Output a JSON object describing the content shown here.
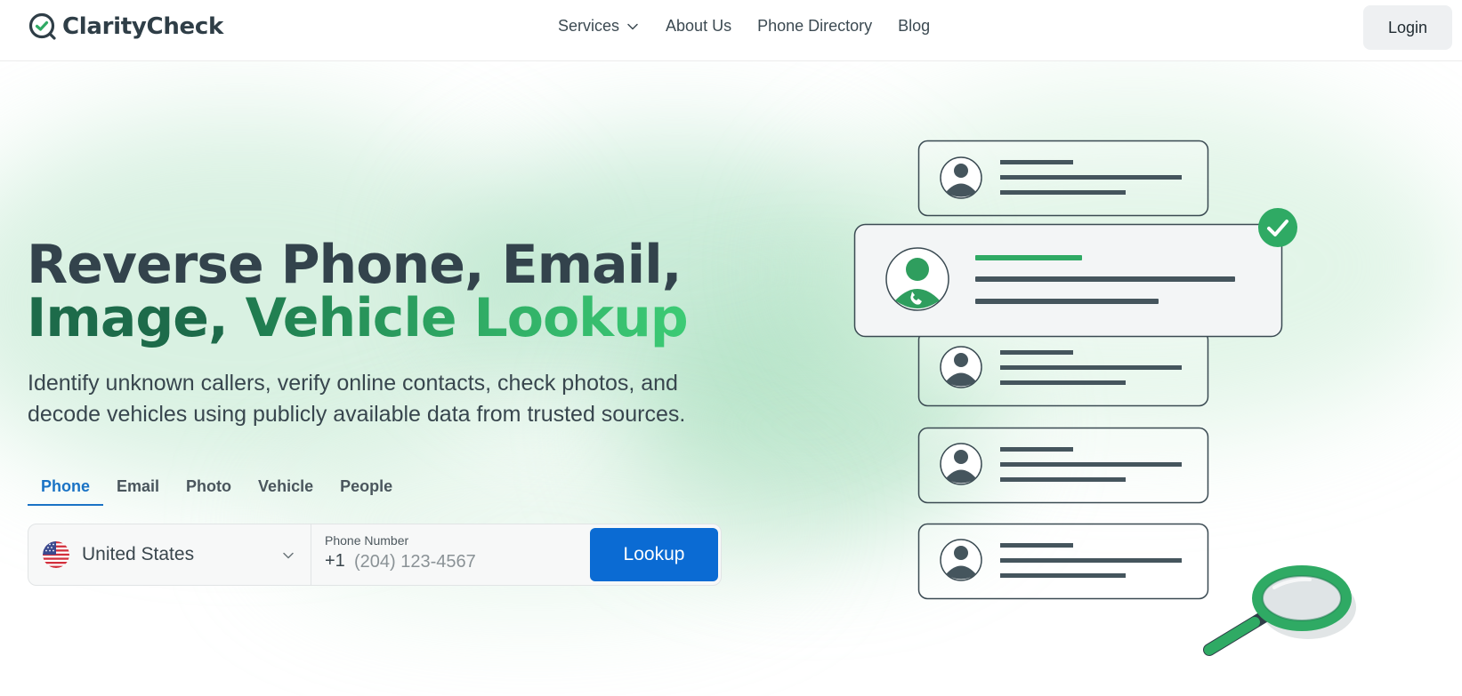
{
  "brand": {
    "name": "ClarityCheck",
    "accent": "#2faa64",
    "primary_blue": "#0b6bd3"
  },
  "nav": {
    "items": [
      {
        "label": "Services",
        "has_dropdown": true
      },
      {
        "label": "About Us"
      },
      {
        "label": "Phone Directory"
      },
      {
        "label": "Blog"
      }
    ],
    "login_label": "Login"
  },
  "hero": {
    "headline": {
      "line1": "Reverse Phone, Email,",
      "line2_part1": "Image, ",
      "line2_part2": "Vehicle Lookup"
    },
    "subtitle": "Identify unknown callers, verify online contacts, check photos, and decode vehicles using publicly available data from trusted sources."
  },
  "search": {
    "tabs": [
      {
        "label": "Phone",
        "active": true
      },
      {
        "label": "Email"
      },
      {
        "label": "Photo"
      },
      {
        "label": "Vehicle"
      },
      {
        "label": "People"
      }
    ],
    "country": {
      "selected": "United States",
      "flag": "us-flag-icon"
    },
    "phone": {
      "label": "Phone Number",
      "prefix": "+1",
      "placeholder": "(204) 123-4567",
      "value": ""
    },
    "submit_label": "Lookup"
  }
}
